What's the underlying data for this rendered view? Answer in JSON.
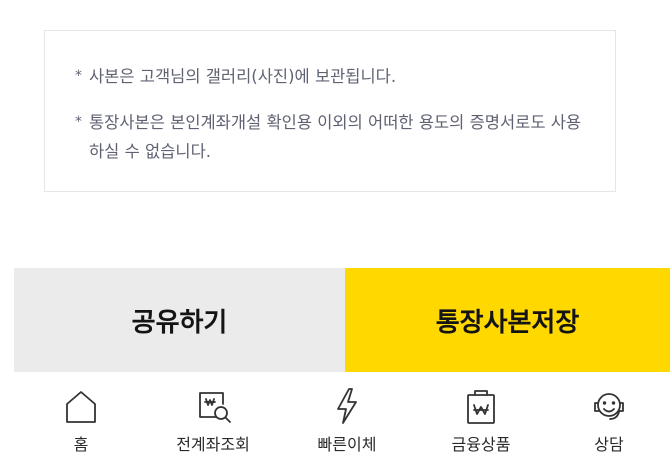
{
  "notice": {
    "bullet": "*",
    "items": [
      "사본은 고객님의 갤러리(사진)에 보관됩니다.",
      "통장사본은 본인계좌개설 확인용 이외의 어떠한 용도의 증명서로도 사용하실 수 없습니다."
    ]
  },
  "actions": {
    "share_label": "공유하기",
    "save_label": "통장사본저장",
    "save_color": "#FFD800",
    "share_color": "#EBEBEB"
  },
  "tabbar": {
    "items": [
      {
        "label": "홈",
        "icon": "home-icon"
      },
      {
        "label": "전계좌조회",
        "icon": "account-search-icon"
      },
      {
        "label": "빠른이체",
        "icon": "lightning-icon"
      },
      {
        "label": "금융상품",
        "icon": "financial-product-icon"
      },
      {
        "label": "상담",
        "icon": "headset-chat-icon"
      }
    ]
  }
}
